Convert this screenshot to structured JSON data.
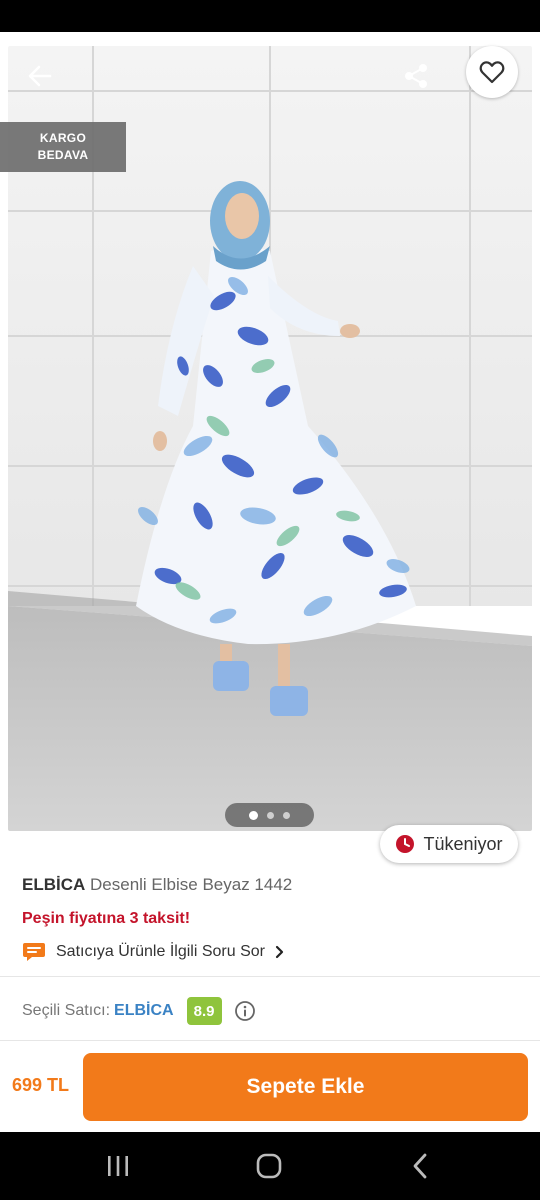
{
  "product": {
    "badge_lines": [
      "KARGO",
      "BEDAVA"
    ],
    "carousel": {
      "count": 3,
      "active": 1
    },
    "stock_label": "Tükeniyor",
    "brand": "ELBİCA",
    "name": "Desenli Elbise Beyaz 1442",
    "installment_text": "Peşin fiyatına 3 taksit!",
    "ask_text": "Satıcıya Ürünle İlgili Soru Sor"
  },
  "seller": {
    "label": "Seçili Satıcı:",
    "name": "ELBİCA",
    "score": "8.9"
  },
  "purchase": {
    "price": "699 TL",
    "cart_label": "Sepete Ekle"
  },
  "icons": {
    "back": "arrow-left-icon",
    "share": "share-icon",
    "favorite": "heart-icon",
    "stock": "clock-icon",
    "ask": "chat-bubble-icon",
    "chevron": "chevron-right-icon",
    "info": "info-icon",
    "nav_recents": "recents-icon",
    "nav_home": "home-icon",
    "nav_back": "nav-back-icon"
  },
  "colors": {
    "accent": "#f27a1a",
    "alert": "#c4142b",
    "seller_link": "#3a82c4",
    "score_bg": "#8fc43c"
  }
}
